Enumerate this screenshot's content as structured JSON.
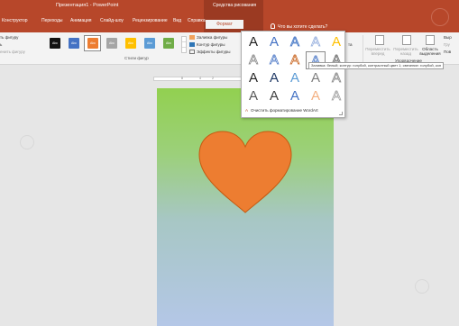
{
  "window": {
    "title": "Презентация1 - PowerPoint",
    "context_group": "Средства рисования"
  },
  "tabs": [
    {
      "label": "Конструктор"
    },
    {
      "label": "Переходы"
    },
    {
      "label": "Анимация"
    },
    {
      "label": "Слайд-шоу"
    },
    {
      "label": "Рецензирование"
    },
    {
      "label": "Вид"
    },
    {
      "label": "Справка"
    },
    {
      "label": "Формат",
      "active": true
    }
  ],
  "tell_me": "Что вы хотите сделать?",
  "ribbon": {
    "left_labels": [
      "ть фигуру",
      "ь",
      "енить фигуру"
    ],
    "style_label": "Abc",
    "shape_styles": [
      {
        "color": "#111111"
      },
      {
        "color": "#4472c4"
      },
      {
        "color": "#ed7d31"
      },
      {
        "color": "#a5a5a5"
      },
      {
        "color": "#ffc000"
      },
      {
        "color": "#5b9bd5"
      },
      {
        "color": "#70ad47"
      }
    ],
    "format": {
      "fill": "Заливка фигуры",
      "outline": "Контур фигуры",
      "effects": "Эффекты фигуры"
    },
    "group_label": "Стили фигур",
    "right_partial": "та",
    "arrange": {
      "forward": "Переместить вперед",
      "backward": "Переместить назад",
      "pane": "Область выделения",
      "group_label": "Упорядочение",
      "align": "Выр",
      "group": "Гру",
      "rotate": "Пов"
    }
  },
  "ruler": {
    "labels": [
      "8",
      "4",
      "2",
      "0"
    ]
  },
  "wordart": {
    "letter": "A",
    "grid": [
      [
        {
          "fill": "#222222"
        },
        {
          "fill": "#4472c4"
        },
        {
          "fill": "#9dc3e6",
          "outline": "#4472c4"
        },
        {
          "fill": "#ffffff",
          "outline": "#8faadc"
        },
        {
          "fill": "#ffc000"
        }
      ],
      [
        {
          "fill": "#ffffff",
          "outline": "#7f7f7f"
        },
        {
          "fill": "#ffffff",
          "outline": "#4472c4"
        },
        {
          "fill": "#ffffff",
          "outline": "#c55a11"
        },
        {
          "fill": "#ffffff",
          "outline": "#4472c4",
          "selected": true
        },
        {
          "fill": "#e0e0e0",
          "outline": "#666666"
        }
      ],
      [
        {
          "fill": "#262626"
        },
        {
          "fill": "#1f3864"
        },
        {
          "fill": "#5b9bd5"
        },
        {
          "fill": "#7f7f7f"
        },
        {
          "fill": "#d9d9d9",
          "outline": "#888888"
        }
      ],
      [
        {
          "fill": "#595959"
        },
        {
          "fill": "#404040"
        },
        {
          "fill": "#4472c4"
        },
        {
          "fill": "#f4b183"
        },
        {
          "fill": "#ffffff",
          "outline": "#999999"
        }
      ]
    ],
    "clear_label": "Очистить форматирование WordArt",
    "tooltip": "Заливка: белый; контур: голубой, контрастный цвет 1; свечение: голубой, кон"
  },
  "slide": {
    "heart_color": "#ed7d31",
    "heart_outline": "#c55a11"
  },
  "colors": {
    "accent": "#b7472a",
    "ribbon_bg": "#f3f3f3",
    "canvas_bg": "#e6e6e6"
  }
}
